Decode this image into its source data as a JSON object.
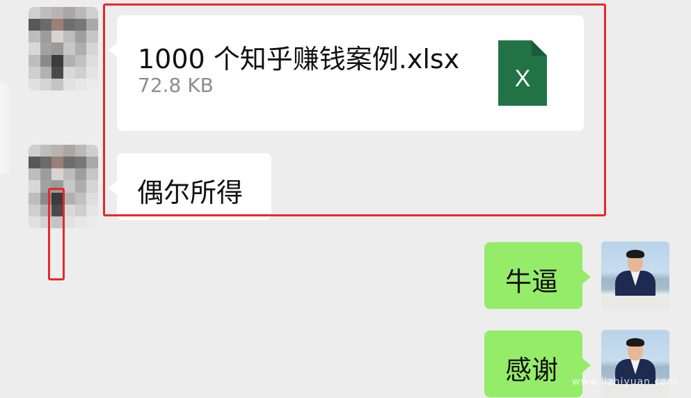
{
  "chat": {
    "file_message": {
      "file_name": "1000 个知乎赚钱案例.xlsx",
      "file_size": "72.8 KB",
      "file_icon": "excel-file-icon",
      "file_icon_letter": "X",
      "file_icon_color": "#217346"
    },
    "received_text": "偶尔所得",
    "sent_messages": [
      "牛逼",
      "感谢"
    ]
  },
  "colors": {
    "background": "#ededed",
    "sent_bubble": "#95ec69",
    "received_bubble": "#ffffff",
    "highlight_box": "#e8272a"
  },
  "watermark": "www.lizhiyuan.com"
}
